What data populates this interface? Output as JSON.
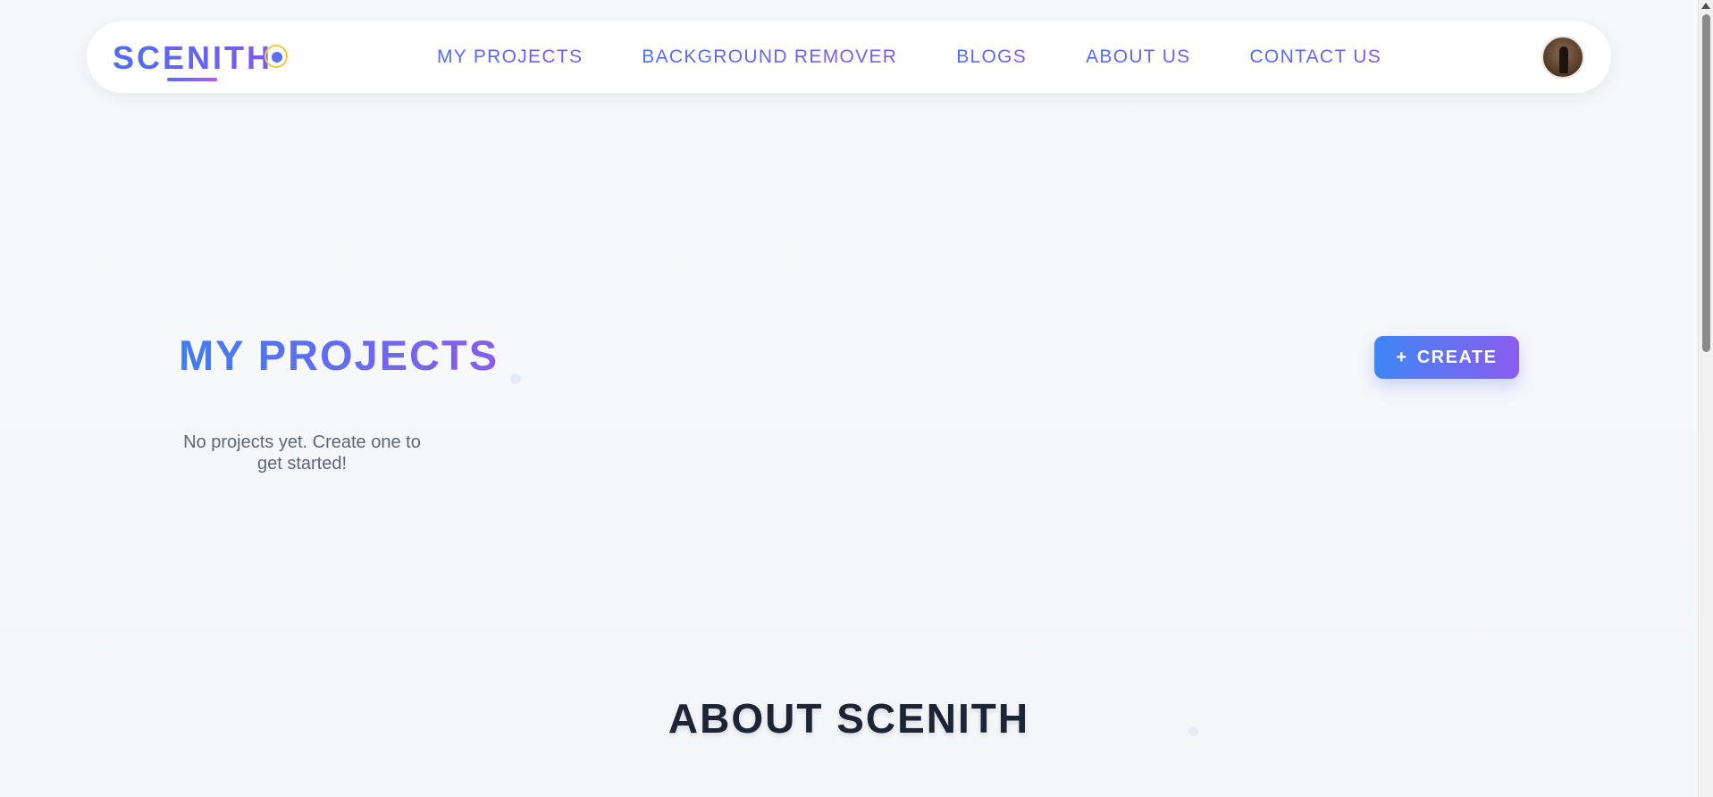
{
  "header": {
    "logo_text": "SCENITH",
    "nav": {
      "my_projects": "MY PROJECTS",
      "background_remover": "BACKGROUND REMOVER",
      "blogs": "BLOGS",
      "about_us": "ABOUT US",
      "contact_us": "CONTACT US"
    },
    "avatar_icon": "user-avatar"
  },
  "projects": {
    "title": "MY PROJECTS",
    "create_label": "CREATE",
    "create_icon": "plus-icon",
    "empty_message": "No projects yet. Create one to get started!"
  },
  "about": {
    "title": "ABOUT SCENITH"
  },
  "colors": {
    "accent_blue": "#4f6df5",
    "accent_purple": "#8a5cf0",
    "logo_dot_yellow": "#f5c842",
    "heading_dark": "#1c2536",
    "background": "#f6f8fb"
  }
}
